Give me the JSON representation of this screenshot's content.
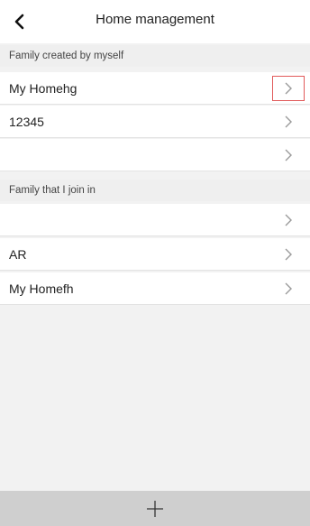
{
  "header": {
    "title": "Home management",
    "back_icon": "chevron-left-icon"
  },
  "sections": [
    {
      "label": "Family created by myself",
      "items": [
        {
          "label": "My Homehg",
          "highlighted": true
        },
        {
          "label": "12345"
        },
        {
          "label": ""
        }
      ]
    },
    {
      "label": "Family that I join in",
      "items": [
        {
          "label": ""
        },
        {
          "label": "AR"
        },
        {
          "label": "My Homefh"
        }
      ]
    }
  ],
  "footer": {
    "add_icon": "plus-icon"
  },
  "colors": {
    "highlight_border": "#e15a5a",
    "background": "#f2f2f2",
    "bottom_bar": "#cfcfcf"
  }
}
